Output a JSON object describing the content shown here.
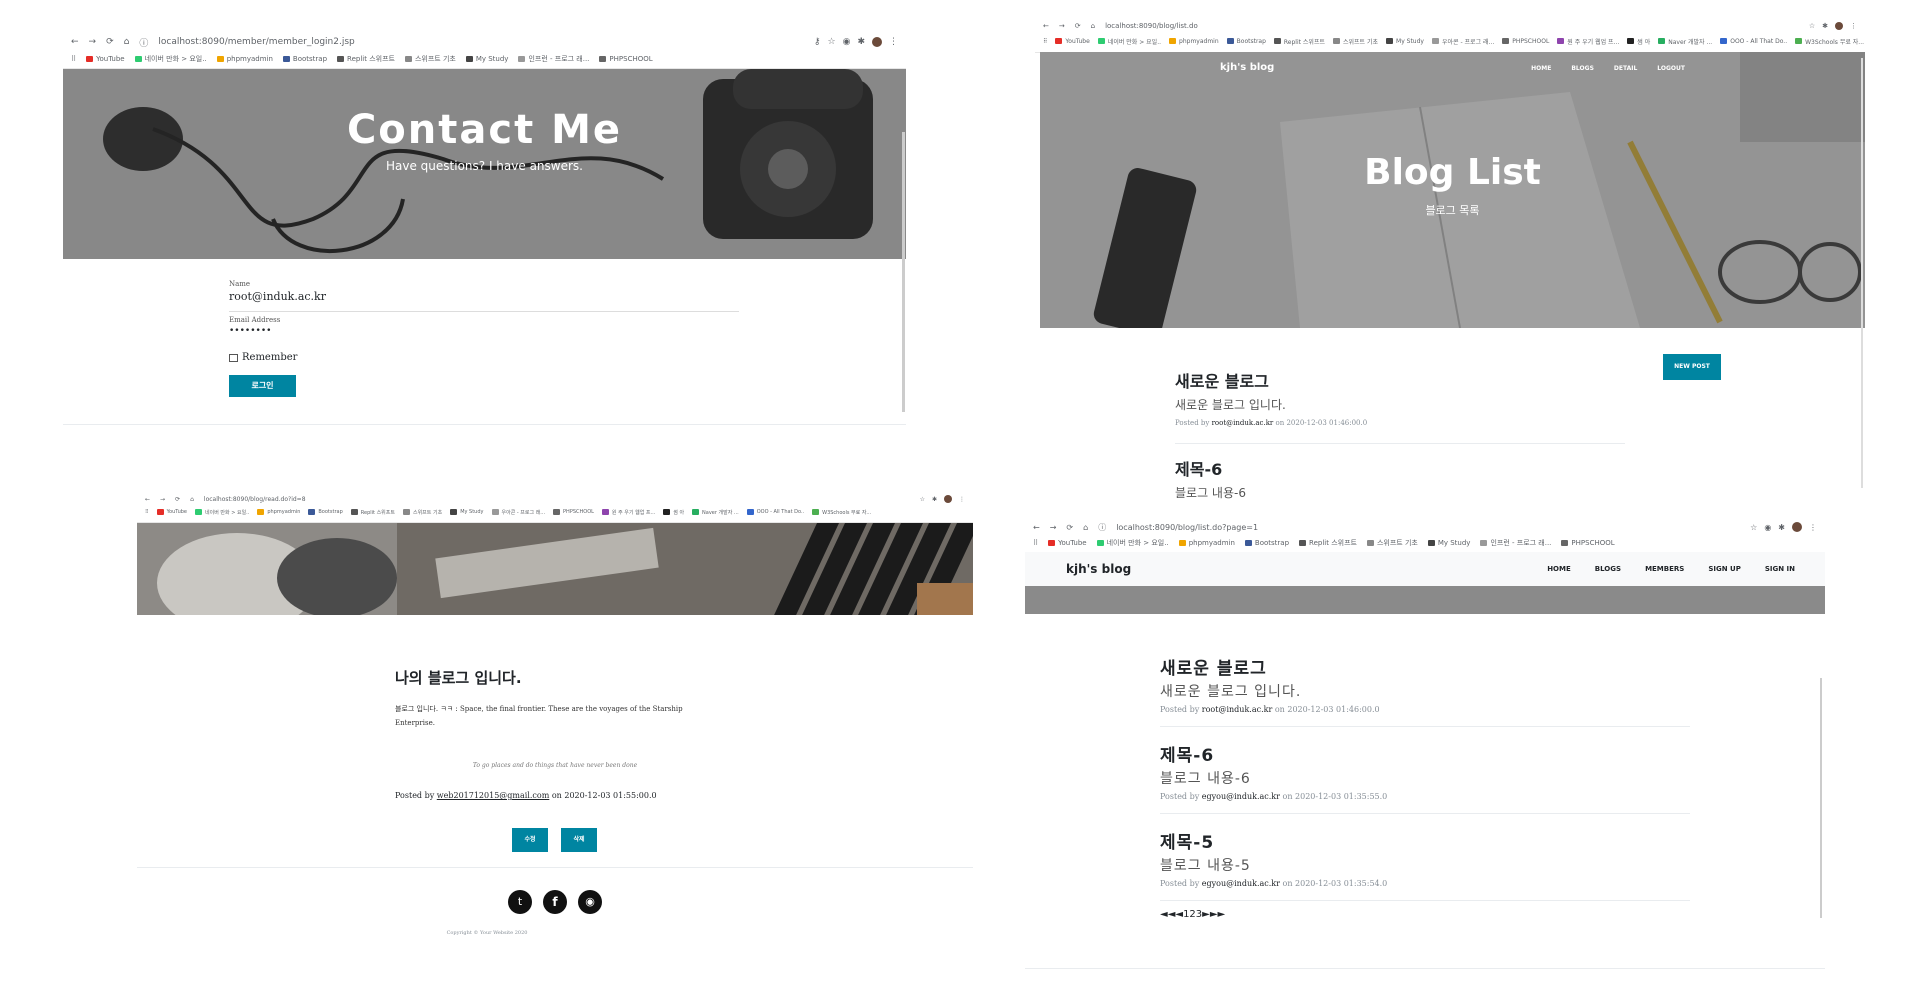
{
  "bookmarks_short": [
    "YouTube",
    "네이버 만화 > 요일..",
    "phpmyadmin",
    "Bootstrap",
    "Replit 스위프트",
    "스위프트 기초",
    "My Study",
    "인프런 - 프로그 래...",
    "PHPSCHOOL"
  ],
  "bookmarks_long": [
    "YouTube",
    "네이버 만화 > 요일..",
    "phpmyadmin",
    "Bootstrap",
    "Replit 스위프트",
    "스위프트 기초",
    "My Study",
    "우아콘 - 프로그 래...",
    "PHPSCHOOL",
    "원 주 우기 웹업 프...",
    "썸 아",
    "Naver 개발자 ...",
    "OOO - All That Do..",
    "W3Schools 무료 자..."
  ],
  "colors": {
    "accent": "#0085a1",
    "overlay": "#5a5a5a"
  },
  "screen1": {
    "url": "localhost:8090/member/member_login2.jsp",
    "hero_title": "Contact Me",
    "hero_subtitle": "Have questions? I have answers.",
    "name_label": "Name",
    "name_value": "root@induk.ac.kr",
    "email_label": "Email Address",
    "password_mask": "••••••••",
    "remember_label": "Remember",
    "login_button": "로그인"
  },
  "screen2": {
    "url": "localhost:8090/blog/list.do",
    "brand": "kjh's blog",
    "nav": [
      "HOME",
      "BLOGS",
      "DETAIL",
      "LOGOUT"
    ],
    "hero_title": "Blog List",
    "hero_subtitle": "블로그 목록",
    "new_post_button": "NEW POST",
    "posts": [
      {
        "title": "새로운 블로그",
        "subtitle": "새로운 블로그 입니다.",
        "meta_prefix": "Posted by",
        "author": "root@induk.ac.kr",
        "meta_suffix": "on 2020-12-03 01:46:00.0"
      },
      {
        "title": "제목-6",
        "subtitle": "블로그 내용-6"
      }
    ]
  },
  "screen3": {
    "url": "localhost:8090/blog/read.do?id=8",
    "post_title": "나의 블로그 입니다.",
    "post_body": "블로그 입니다. ㅋㅋ : Space, the final frontier. These are the voyages of the Starship Enterprise.",
    "quote": "To go places and do things that have never been done",
    "meta_prefix": "Posted by",
    "author": "web201712015@gmail.com",
    "meta_suffix": "on 2020-12-03 01:55:00.0",
    "edit_button": "수정",
    "delete_button": "삭제",
    "social": [
      "twitter-icon",
      "facebook-icon",
      "github-icon"
    ],
    "copyright": "Copyright © Your Website 2020"
  },
  "screen4": {
    "url": "localhost:8090/blog/list.do?page=1",
    "brand": "kjh's blog",
    "nav": [
      "HOME",
      "BLOGS",
      "MEMBERS",
      "SIGN UP",
      "SIGN IN"
    ],
    "posts": [
      {
        "title": "새로운 블로그",
        "subtitle": "새로운 블로그 입니다.",
        "meta_prefix": "Posted by",
        "author": "root@induk.ac.kr",
        "meta_suffix": "on 2020-12-03 01:46:00.0"
      },
      {
        "title": "제목-6",
        "subtitle": "블로그 내용-6",
        "meta_prefix": "Posted by",
        "author": "egyou@induk.ac.kr",
        "meta_suffix": "on 2020-12-03 01:35:55.0"
      },
      {
        "title": "제목-5",
        "subtitle": "블로그 내용-5",
        "meta_prefix": "Posted by",
        "author": "egyou@induk.ac.kr",
        "meta_suffix": "on 2020-12-03 01:35:54.0"
      }
    ],
    "pagination": "◄◄◄123►►►"
  }
}
